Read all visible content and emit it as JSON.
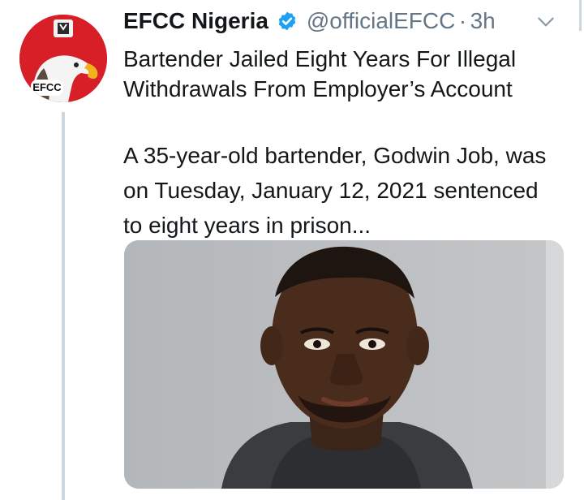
{
  "tweet": {
    "display_name": "EFCC Nigeria",
    "handle": "@officialEFCC",
    "separator": "·",
    "time": "3h",
    "headline": "Bartender Jailed Eight Years For Illegal Withdrawals From Employer’s Account",
    "body": "A 35-year-old bartender, Godwin Job, was on Tuesday, January 12, 2021 sentenced to eight years in prison...",
    "avatar_text": "EFCC",
    "verified": true,
    "icons": [
      "verified-badge-icon",
      "chevron-down-icon"
    ]
  },
  "colors": {
    "brand_red": "#d61f26",
    "verified_blue": "#1da1f2",
    "secondary_text": "#657786",
    "thread_line": "#ccd6dd"
  }
}
